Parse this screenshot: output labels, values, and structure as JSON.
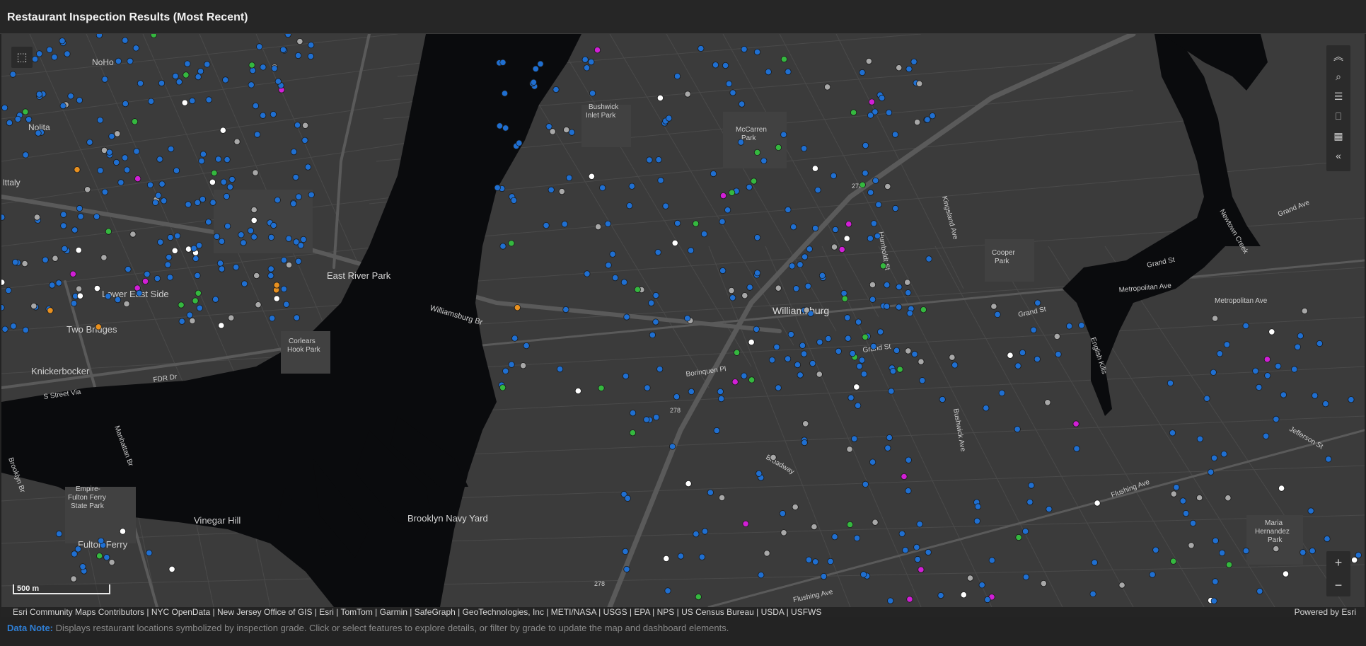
{
  "header": {
    "title": "Restaurant Inspection Results (Most Recent)"
  },
  "map": {
    "labels": {
      "noho": "NoHo",
      "nolita": "Nolita",
      "little_italy": "lttaly",
      "lower_east_side": "Lower East Side",
      "two_bridges": "Two Bridges",
      "knickerbocker": "Knickerbocker",
      "east_river_park": "East River Park",
      "williamsburg_br": "Williamsburg Br",
      "corlears_hook_park_1": "Corlears",
      "corlears_hook_park_2": "Hook Park",
      "fdr_dr": "FDR Dr",
      "s_street_via": "S Street Via",
      "manhattan_br": "Manhattan Br",
      "brooklyn_br": "Brooklyn Br",
      "empire_1": "Empire-",
      "empire_2": "Fulton Ferry",
      "empire_3": "State Park",
      "vinegar_hill": "Vinegar Hill",
      "fulton_ferry": "Fulton Ferry",
      "brooklyn_navy_yard": "Brooklyn Navy Yard",
      "bushwick_1": "Bushwick",
      "bushwick_2": "Inlet Park",
      "mccarren_1": "McCarren",
      "mccarren_2": "Park",
      "williamsburg": "Williamsburg",
      "cooper_1": "Cooper",
      "cooper_2": "Park",
      "metropolitan_ave_1": "Metropolitan Ave",
      "metropolitan_ave_2": "Metropolitan Ave",
      "grand_st_1": "Grand St",
      "grand_st_2": "Grand St",
      "grand_st_3": "Grand St",
      "grand_ave": "Grand Ave",
      "english_kills": "English Kills",
      "newtown_creek": "Newtown Creek",
      "humboldt_st": "Humboldt St",
      "bushwick_ave": "Bushwick Ave",
      "flushing_ave": "Flushing Ave",
      "borinquen_pl": "Borinquen Pl",
      "broadway": "Broadway",
      "maria_1": "Maria",
      "maria_2": "Hernandez",
      "maria_3": "Park",
      "route_278_1": "278",
      "route_278_2": "278",
      "route_278_3": "278",
      "kingsland_ave": "Kingsland Ave",
      "flushing_ave_2": "Flushing Ave",
      "jefferson_st": "Jefferson St"
    },
    "colors": {
      "grade_a": "#1f6fd1",
      "grade_b": "#35b83f",
      "grade_c": "#e8901f",
      "pending": "#d11fd6",
      "not_graded": "#a8a8a8",
      "closed": "#ffffff"
    },
    "scalebar_label": "500 m"
  },
  "toolbar": {
    "icons": [
      "chevrons-up-icon",
      "search-icon",
      "legend-list-icon",
      "bookmark-icon",
      "qr-grid-icon",
      "chevrons-left-icon"
    ]
  },
  "zoom": {
    "in": "+",
    "out": "−"
  },
  "attribution": {
    "text": "Esri Community Maps Contributors | NYC OpenData | New Jersey Office of GIS | Esri | TomTom | Garmin | SafeGraph | GeoTechnologies, Inc | METI/NASA | USGS | EPA | NPS | US Census Bureau | USDA | USFWS",
    "powered_by": "Powered by Esri"
  },
  "note": {
    "label": "Data Note:",
    "text": "Displays restaurant locations symbolized by inspection grade. Click or select features to explore details, or filter by grade to update the map and dashboard elements."
  }
}
